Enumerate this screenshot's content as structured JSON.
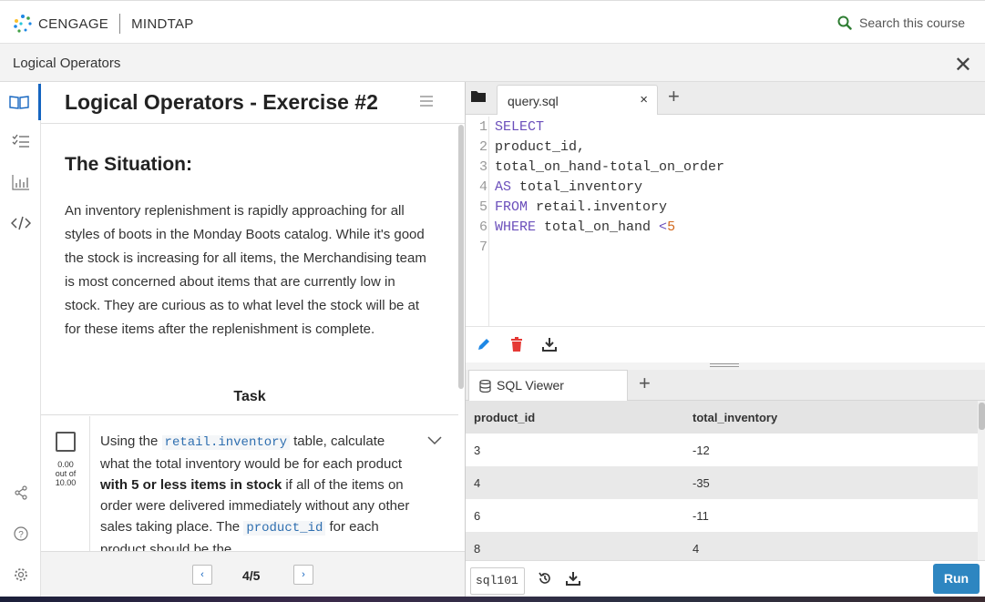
{
  "brand": {
    "company": "CENGAGE",
    "product": "MINDTAP"
  },
  "search": {
    "placeholder": "Search this course"
  },
  "titlebar": {
    "title": "Logical Operators"
  },
  "instructions": {
    "title": "Logical Operators - Exercise #2",
    "situation_heading": "The Situation:",
    "situation_text": "An inventory replenishment is rapidly approaching for all styles of boots in the Monday Boots catalog. While it's good the stock is increasing for all items, the Merchandising team is most concerned about items that are currently low in stock. They are curious as to what level the stock will be at for these items after the replenishment is complete.",
    "task_heading": "Task",
    "task": {
      "score_value": "0.00",
      "score_of": "out of",
      "score_max": "10.00",
      "text_1": "Using the ",
      "code_1": "retail.inventory",
      "text_2": " table, calculate what the total inventory would be for each product ",
      "bold_1": "with 5 or less items in stock",
      "text_3": " if all of the items on order were delivered immediately without any other sales taking place. The ",
      "code_2": "product_id",
      "text_4": " for each product should be the"
    },
    "pager": {
      "prev": "‹",
      "next": "›",
      "position": "4/5"
    }
  },
  "editor": {
    "file_tab": "query.sql",
    "tab_close": "×",
    "add_tab": "+",
    "line_numbers": [
      "1",
      "2",
      "3",
      "4",
      "5",
      "6",
      "7"
    ],
    "code": {
      "l1_kw": "SELECT",
      "l2": "product_id,",
      "l3": "total_on_hand-total_on_order",
      "l4_kw": "AS",
      "l4_rest": " total_inventory",
      "l5_kw": "FROM",
      "l5_rest": " retail.inventory",
      "l6_kw": "WHERE",
      "l6_rest": " total_on_hand ",
      "l6_op": "<",
      "l6_num": "5"
    }
  },
  "viewer": {
    "tab_label": "SQL Viewer",
    "add_tab": "+",
    "columns": [
      "product_id",
      "total_inventory"
    ],
    "rows": [
      [
        "3",
        "-12"
      ],
      [
        "4",
        "-35"
      ],
      [
        "6",
        "-11"
      ],
      [
        "8",
        "4"
      ]
    ]
  },
  "bottom": {
    "database": "sql101",
    "run_label": "Run"
  },
  "colors": {
    "accent": "#2e86c1",
    "keyword": "#6b4fbb",
    "number": "#d2691e",
    "code_inline": "#2f6fb0"
  }
}
